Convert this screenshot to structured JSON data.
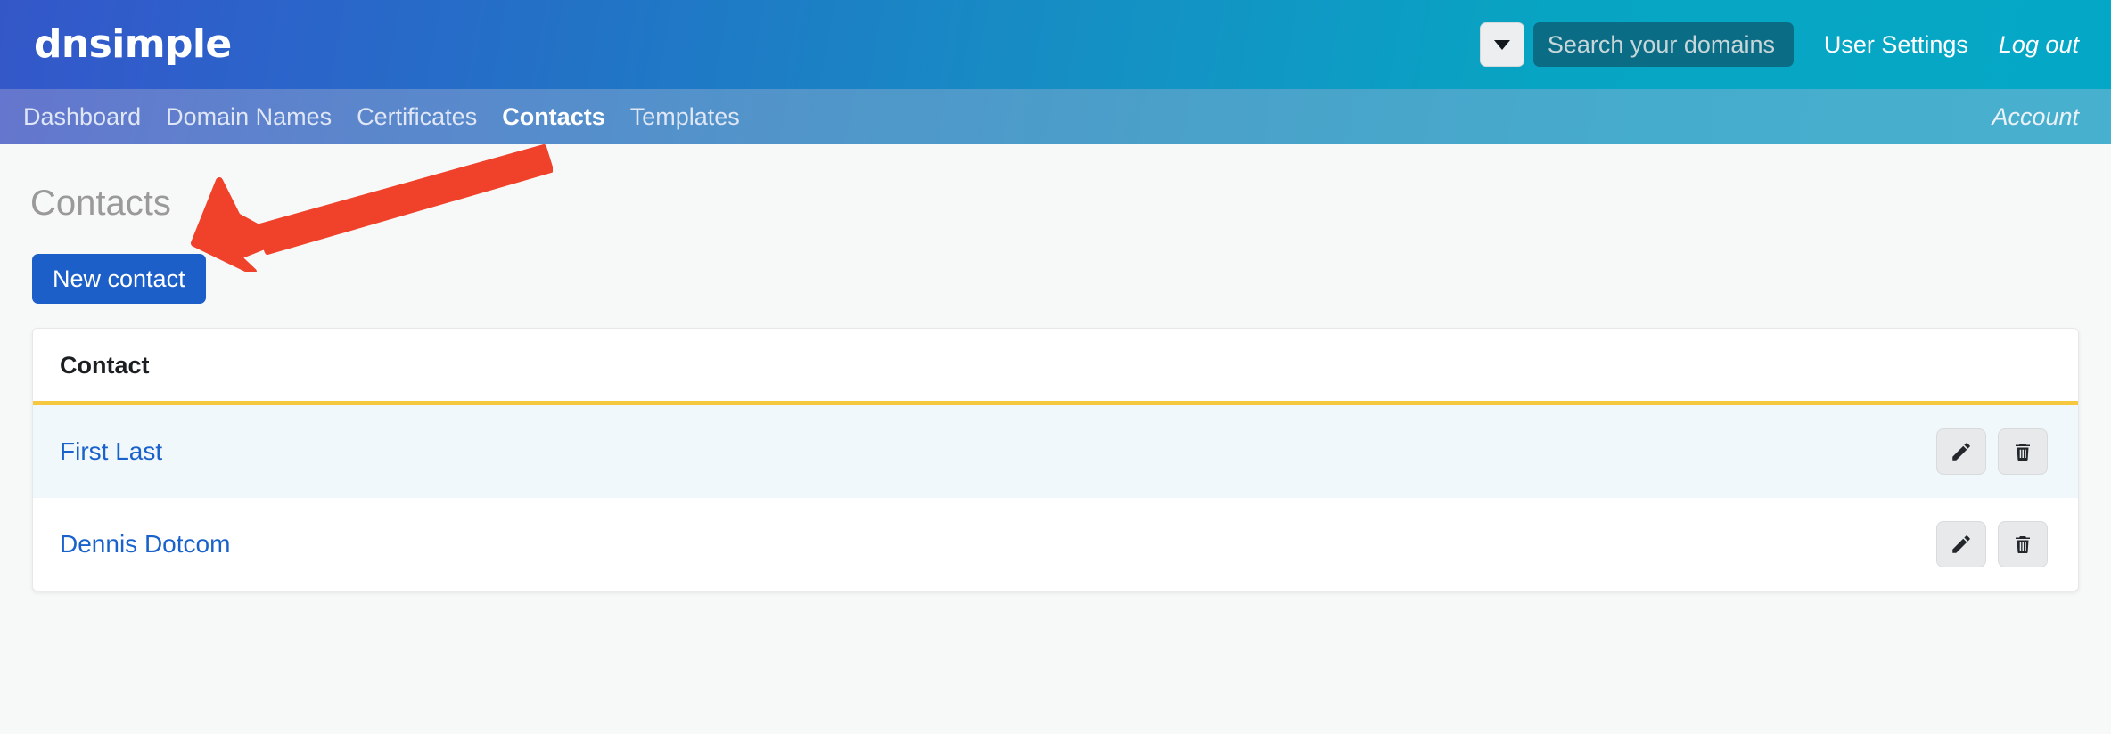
{
  "header": {
    "logo_text": "dnsimple",
    "search": {
      "dropdown_icon": "chevron-down-icon",
      "placeholder": "Search your domains",
      "value": ""
    },
    "links": [
      {
        "label": "User Settings",
        "italic": false
      },
      {
        "label": "Log out",
        "italic": true
      }
    ]
  },
  "nav": {
    "items": [
      {
        "label": "Dashboard",
        "active": false
      },
      {
        "label": "Domain Names",
        "active": false
      },
      {
        "label": "Certificates",
        "active": false
      },
      {
        "label": "Contacts",
        "active": true
      },
      {
        "label": "Templates",
        "active": false
      }
    ],
    "right_label": "Account"
  },
  "main": {
    "page_title": "Contacts",
    "new_contact_label": "New contact",
    "table": {
      "columns": [
        "Contact",
        ""
      ],
      "rows": [
        {
          "name": "First Last",
          "edit_icon": "pencil-icon",
          "delete_icon": "trash-icon"
        },
        {
          "name": "Dennis Dotcom",
          "edit_icon": "pencil-icon",
          "delete_icon": "trash-icon"
        }
      ]
    }
  },
  "annotation": {
    "type": "arrow",
    "color": "#f0412a",
    "points_to": "new-contact-button"
  },
  "colors": {
    "header_gradient_start": "#3457c8",
    "header_gradient_end": "#04a8c6",
    "nav_gradient_start": "#6476cd",
    "nav_gradient_end": "#48b0cf",
    "primary_button": "#1c5fc9",
    "link": "#1a62cb",
    "table_accent": "#f5c83f",
    "page_background": "#f7f8f8",
    "row_striped": "#f1f8fc",
    "annotation": "#f0412a"
  }
}
